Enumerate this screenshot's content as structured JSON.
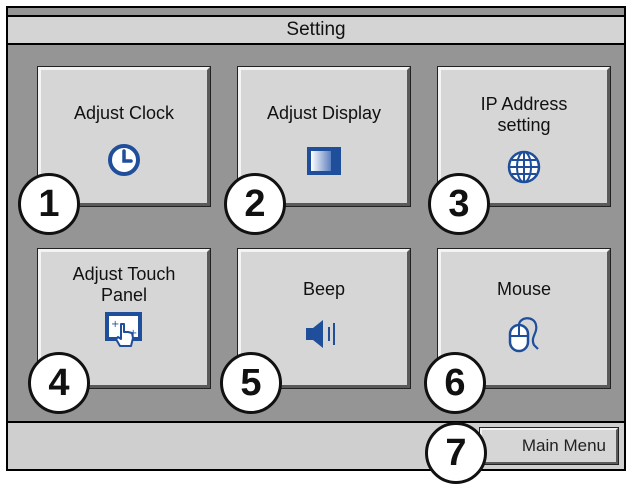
{
  "window": {
    "title": "Setting"
  },
  "tiles": [
    {
      "label": "Adjust Clock",
      "icon": "clock-icon",
      "badge": "1"
    },
    {
      "label": "Adjust Display",
      "icon": "display-icon",
      "badge": "2"
    },
    {
      "label_line1": "IP Address",
      "label_line2": "setting",
      "icon": "globe-icon",
      "badge": "3"
    },
    {
      "label_line1": "Adjust Touch",
      "label_line2": "Panel",
      "icon": "touch-panel-icon",
      "badge": "4"
    },
    {
      "label": "Beep",
      "icon": "speaker-icon",
      "badge": "5"
    },
    {
      "label": "Mouse",
      "icon": "mouse-icon",
      "badge": "6"
    }
  ],
  "footer": {
    "main_menu_label": "Main Menu",
    "badge": "7"
  },
  "colors": {
    "accent": "#1f4e9a",
    "panel": "#959595",
    "button": "#d6d6d6"
  }
}
